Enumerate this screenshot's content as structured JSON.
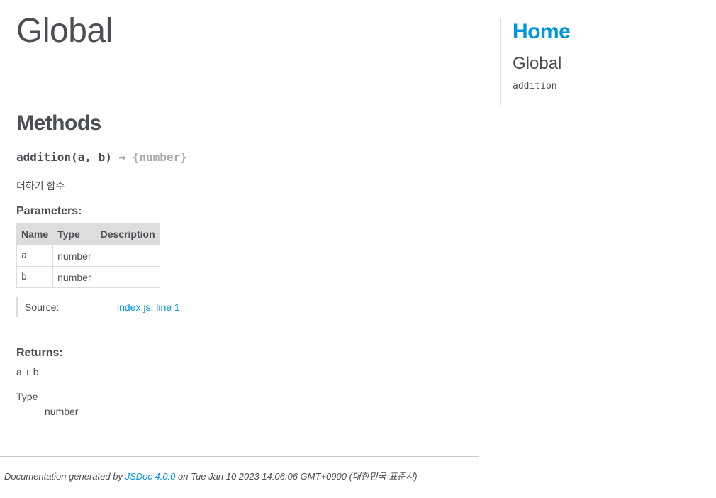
{
  "main": {
    "page_title": "Global",
    "methods_heading": "Methods",
    "method": {
      "signature": "addition(a, b)",
      "return_type": "→ {number}",
      "description": "더하기 함수",
      "params_heading": "Parameters:",
      "param_columns": [
        "Name",
        "Type",
        "Description"
      ],
      "params": [
        {
          "name": "a",
          "type": "number",
          "description": ""
        },
        {
          "name": "b",
          "type": "number",
          "description": ""
        }
      ],
      "source_label": "Source:",
      "source_file": "index.js",
      "source_sep": ",",
      "source_line": "line 1",
      "returns_heading": "Returns:",
      "returns_desc": "a + b",
      "type_label": "Type",
      "type_value": "number"
    }
  },
  "nav": {
    "home": "Home",
    "section": "Global",
    "items": [
      "addition"
    ]
  },
  "footer": {
    "prefix": "Documentation generated by",
    "link": "JSDoc 4.0.0",
    "suffix": "on Tue Jan 10 2023 14:06:06 GMT+0900 (대한민국 표준시)"
  },
  "colors": {
    "link": "#0095dd",
    "text": "#4d4e53",
    "table_header_bg": "#dddddd"
  }
}
